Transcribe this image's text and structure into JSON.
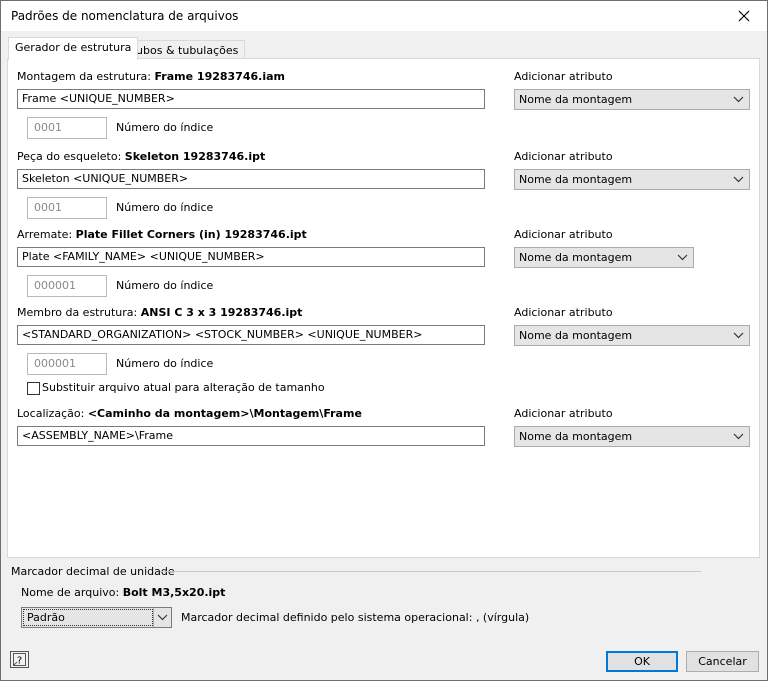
{
  "dialog": {
    "title": "Padrões de nomenclatura de arquivos",
    "tabs": [
      "Gerador de estrutura",
      "Tubos & tubulações"
    ]
  },
  "sections": [
    {
      "label": "Montagem da estrutura:",
      "value_bold": "Frame 19283746.iam",
      "pattern": "Frame <UNIQUE_NUMBER>",
      "index_number": "0001",
      "index_label": "Número do índice",
      "attribute_label": "Adicionar atributo",
      "attribute_value": "Nome da montagem"
    },
    {
      "label": "Peça do esqueleto:",
      "value_bold": "Skeleton 19283746.ipt",
      "pattern": "Skeleton <UNIQUE_NUMBER>",
      "index_number": "0001",
      "index_label": "Número do índice",
      "attribute_label": "Adicionar atributo",
      "attribute_value": "Nome da montagem"
    },
    {
      "label": "Arremate:",
      "value_bold": "Plate Fillet Corners (in) 19283746.ipt",
      "pattern": "Plate <FAMILY_NAME> <UNIQUE_NUMBER>",
      "index_number": "000001",
      "index_label": "Número do índice",
      "attribute_label": "Adicionar atributo",
      "attribute_value": "Nome da montagem"
    },
    {
      "label": "Membro da estrutura:",
      "value_bold": "ANSI C 3 x 3 19283746.ipt",
      "pattern": "<STANDARD_ORGANIZATION> <STOCK_NUMBER> <UNIQUE_NUMBER>",
      "index_number": "000001",
      "index_label": "Número do índice",
      "attribute_label": "Adicionar atributo",
      "attribute_value": "Nome da montagem",
      "checkbox_label": "Substituir arquivo atual para alteração de tamanho",
      "checkbox_checked": false
    }
  ],
  "location": {
    "label": "Localização:",
    "value_bold": "<Caminho da montagem>\\Montagem\\Frame",
    "pattern": "<ASSEMBLY_NAME>\\Frame",
    "attribute_label": "Adicionar atributo",
    "attribute_value": "Nome da montagem"
  },
  "decimal_marker": {
    "group_label": "Marcador decimal de unidade",
    "filename_label": "Nome de arquivo:",
    "filename_value": "Bolt M3,5x20.ipt",
    "select_value": "Padrão",
    "info_text": "Marcador decimal definido pelo sistema operacional: , (vírgula)"
  },
  "buttons": {
    "ok": "OK",
    "cancel": "Cancelar"
  }
}
